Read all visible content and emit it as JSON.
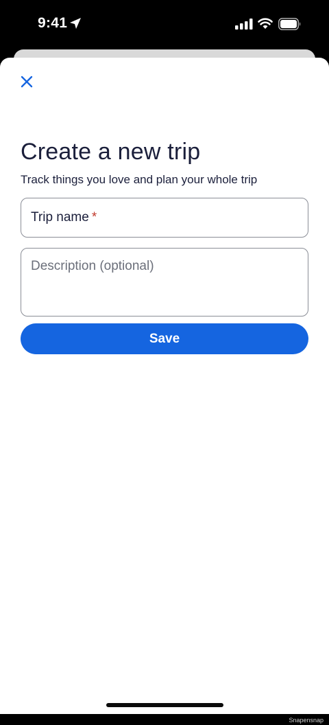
{
  "status_bar": {
    "time": "9:41",
    "icons": [
      "location-arrow-icon",
      "cellular-signal-icon",
      "wifi-icon",
      "battery-icon"
    ]
  },
  "header": {
    "close_icon": "close-icon"
  },
  "main": {
    "title": "Create a new trip",
    "subtitle": "Track things you love and plan your whole trip",
    "trip_name": {
      "label": "Trip name",
      "required_mark": "*",
      "value": ""
    },
    "description": {
      "placeholder": "Description (optional)",
      "value": ""
    },
    "save_label": "Save"
  },
  "footer": {
    "watermark": "Snapensnap"
  },
  "colors": {
    "accent": "#1565e0",
    "text_primary": "#1b1f3b",
    "required": "#c0392b",
    "border": "#8a8d96",
    "placeholder": "#6b6f7a"
  }
}
